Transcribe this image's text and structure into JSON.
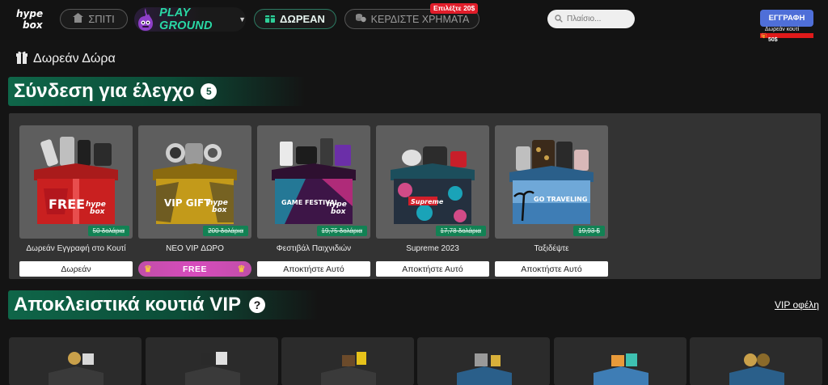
{
  "header": {
    "logo_icon": "hype-box-logo",
    "nav": {
      "home_label": "ΣΠΙΤΙ",
      "play_label": "PLAY GROUND",
      "free_label": "ΔΩΡΕΑΝ",
      "earn_label": "ΚΕΡΔΙΣΤΕ ΧΡΗΜΑΤΑ",
      "earn_badge": "Επιλέξτε 20$"
    },
    "search": {
      "placeholder": "Πλαίσιο..."
    },
    "signup_label": "ΕΓΓΡΑΦΗ",
    "promo": {
      "text": "Δωρεάν κουτί",
      "amount": "50$"
    }
  },
  "page": {
    "title": "Δωρεάν Δώρα"
  },
  "login_section": {
    "title": "Σύνδεση για έλεγχο",
    "count": "5"
  },
  "boxes": [
    {
      "name": "Δωρεάν Εγγραφή στο Κουτί",
      "price": "50 δολάρια",
      "button": "Δωρεάν",
      "box_label": "FREE"
    },
    {
      "name": "ΝΕΟ VIP ΔΩΡΟ",
      "price": "200 δολάρια",
      "button": "FREE",
      "box_label": "VIP GIFT"
    },
    {
      "name": "Φεστιβάλ Παιχνιδιών",
      "price": "19,75 δολάρια",
      "button": "Αποκτήστε Αυτό",
      "box_label": "GAME FESTIVAL"
    },
    {
      "name": "Supreme 2023",
      "price": "17,78 δολάρια",
      "button": "Αποκτήστε Αυτό",
      "box_label": "Supreme"
    },
    {
      "name": "Ταξιδέψτε",
      "price": "19,93 $",
      "button": "Αποκτήστε Αυτό",
      "box_label": "GO TRAVELING"
    }
  ],
  "vip_section": {
    "title": "Αποκλειστικά κουτιά VIP",
    "help": "?",
    "benefits_link": "VIP οφέλη"
  },
  "colors": {
    "accent_green": "#0f6649",
    "price_green": "#128254",
    "signup_blue": "#4f6fd8",
    "vip_pink": "#d74cbc",
    "badge_red": "#e11d2a"
  }
}
